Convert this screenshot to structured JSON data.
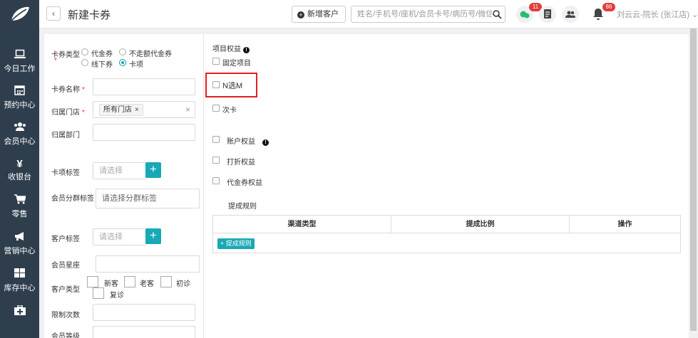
{
  "sidebar": {
    "items": [
      {
        "label": "今日工作",
        "icon": "laptop-icon",
        "glyph": "💻"
      },
      {
        "label": "预约中心",
        "icon": "calendar-icon",
        "glyph": "▦"
      },
      {
        "label": "会员中心",
        "icon": "users-icon",
        "glyph": "👥"
      },
      {
        "label": "收银台",
        "icon": "yen-icon",
        "glyph": "¥"
      },
      {
        "label": "零售",
        "icon": "cart-icon",
        "glyph": "🛒"
      },
      {
        "label": "营销中心",
        "icon": "megaphone-icon",
        "glyph": "📢"
      },
      {
        "label": "库存中心",
        "icon": "grid-icon",
        "glyph": "▦"
      },
      {
        "label": "",
        "icon": "medkit-icon",
        "glyph": "✚"
      }
    ]
  },
  "header": {
    "back_label": "‹",
    "title": "新建卡券",
    "new_customer_label": "新增客户",
    "search_placeholder": "姓名/手机号/座机/会员卡号/病历号/微信号",
    "wechat_badge": "11",
    "bell_badge": "86",
    "user": "刘云云-院长 (张江店)",
    "user_caret": "⌄"
  },
  "form": {
    "card_type_label": "卡券类型",
    "card_type_options": [
      "代金券",
      "不走额代金券",
      "线下券",
      "卡项"
    ],
    "card_type_selected": "卡项",
    "required_mark": "*",
    "card_name_label": "卡券名称",
    "store_label": "归属门店",
    "store_tag": "所有门店",
    "tag_remove": "×",
    "clear": "×",
    "dept_label": "归属部门",
    "card_tag_label": "卡项标签",
    "card_tag_placeholder": "请选择",
    "plus": "+",
    "member_group_label": "会员分群标签",
    "member_group_placeholder": "请选择分群标签",
    "customer_tag_label": "客户标签",
    "customer_tag_placeholder": "请选择",
    "member_star_label": "会员星座",
    "customer_type_label": "客户类型",
    "customer_types": [
      "新客",
      "老客",
      "初诊",
      "复诊"
    ],
    "limit_times_label": "限制次数",
    "member_level_label": "会员等级"
  },
  "rights": {
    "section_label": "项目权益",
    "info_glyph": "!",
    "options": [
      "固定项目",
      "N选M",
      "次卡"
    ],
    "account_rights": "账户权益",
    "discount_rights": "打折权益",
    "voucher_rights": "代金券权益",
    "commission_rule": "提成规则",
    "table_headers": [
      "渠道类型",
      "提成比例",
      "操作"
    ],
    "add_rule_label": "+ 提成规则"
  },
  "colors": {
    "accent": "#17a9b5",
    "sidebar": "#2f3e4d",
    "highlight": "#e0211f",
    "badge": "#e23b3b"
  }
}
